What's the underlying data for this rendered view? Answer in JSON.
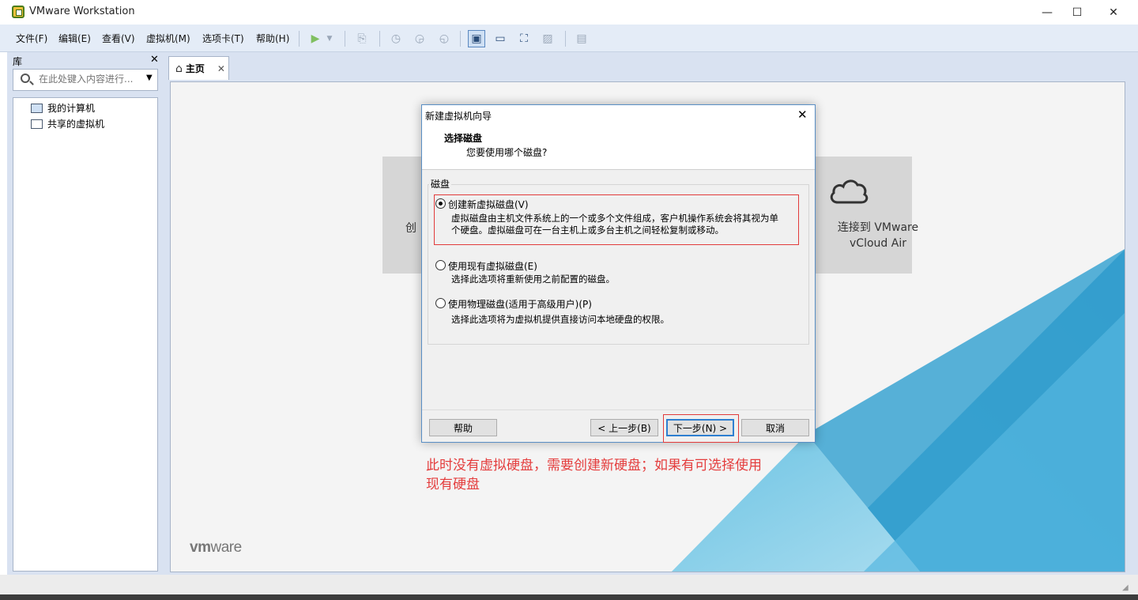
{
  "window": {
    "title": "VMware Workstation",
    "controls": {
      "minimize": "—",
      "maximize": "☐",
      "close": "✕"
    }
  },
  "menu": {
    "items": [
      "文件(F)",
      "编辑(E)",
      "查看(V)",
      "虚拟机(M)",
      "选项卡(T)",
      "帮助(H)"
    ]
  },
  "toolbar": {
    "icons": [
      "play-icon",
      "dropdown-icon",
      "network-icon",
      "snapshot-take-icon",
      "snapshot-revert-icon",
      "snapshot-manager-icon",
      "view-library-icon",
      "view-console-icon",
      "fullscreen-icon",
      "unity-icon",
      "thumbnail-icon"
    ]
  },
  "library": {
    "title": "库",
    "close": "✕",
    "search_placeholder": "在此处键入内容进行...",
    "tree": [
      {
        "label": "我的计算机",
        "icon": "computer-icon"
      },
      {
        "label": "共享的虚拟机",
        "icon": "shared-vm-icon"
      }
    ]
  },
  "tabs": [
    {
      "label": "主页",
      "icon": "home-icon",
      "close": "✕"
    }
  ],
  "home": {
    "card_left_label": "创",
    "card_right_label_1": "连接到 VMware",
    "card_right_label_2": "vCloud Air",
    "logo_vm": "vm",
    "logo_ware": "ware"
  },
  "dialog": {
    "title": "新建虚拟机向导",
    "close": "✕",
    "heading": "选择磁盘",
    "subheading": "您要使用哪个磁盘?",
    "group_label": "磁盘",
    "options": [
      {
        "label": "创建新虚拟磁盘(V)",
        "desc_1": "虚拟磁盘由主机文件系统上的一个或多个文件组成，客户机操作系统会将其视为单",
        "desc_2": "个硬盘。虚拟磁盘可在一台主机上或多台主机之间轻松复制或移动。",
        "checked": true
      },
      {
        "label": "使用现有虚拟磁盘(E)",
        "desc_1": "选择此选项将重新使用之前配置的磁盘。",
        "checked": false
      },
      {
        "label": "使用物理磁盘(适用于高级用户)(P)",
        "desc_1": "选择此选项将为虚拟机提供直接访问本地硬盘的权限。",
        "checked": false
      }
    ],
    "buttons": {
      "help": "帮助",
      "back": "< 上一步(B)",
      "next": "下一步(N) >",
      "cancel": "取消"
    }
  },
  "annotation": {
    "line_1": "此时没有虚拟硬盘，需要创建新硬盘；如果有可选择使用",
    "line_2": "现有硬盘"
  },
  "colors": {
    "accent": "#2f7fd0",
    "highlight": "#e23b3b",
    "toolbar_bg": "#e4ecf7",
    "vmware_blue": "#1a8bc4"
  }
}
